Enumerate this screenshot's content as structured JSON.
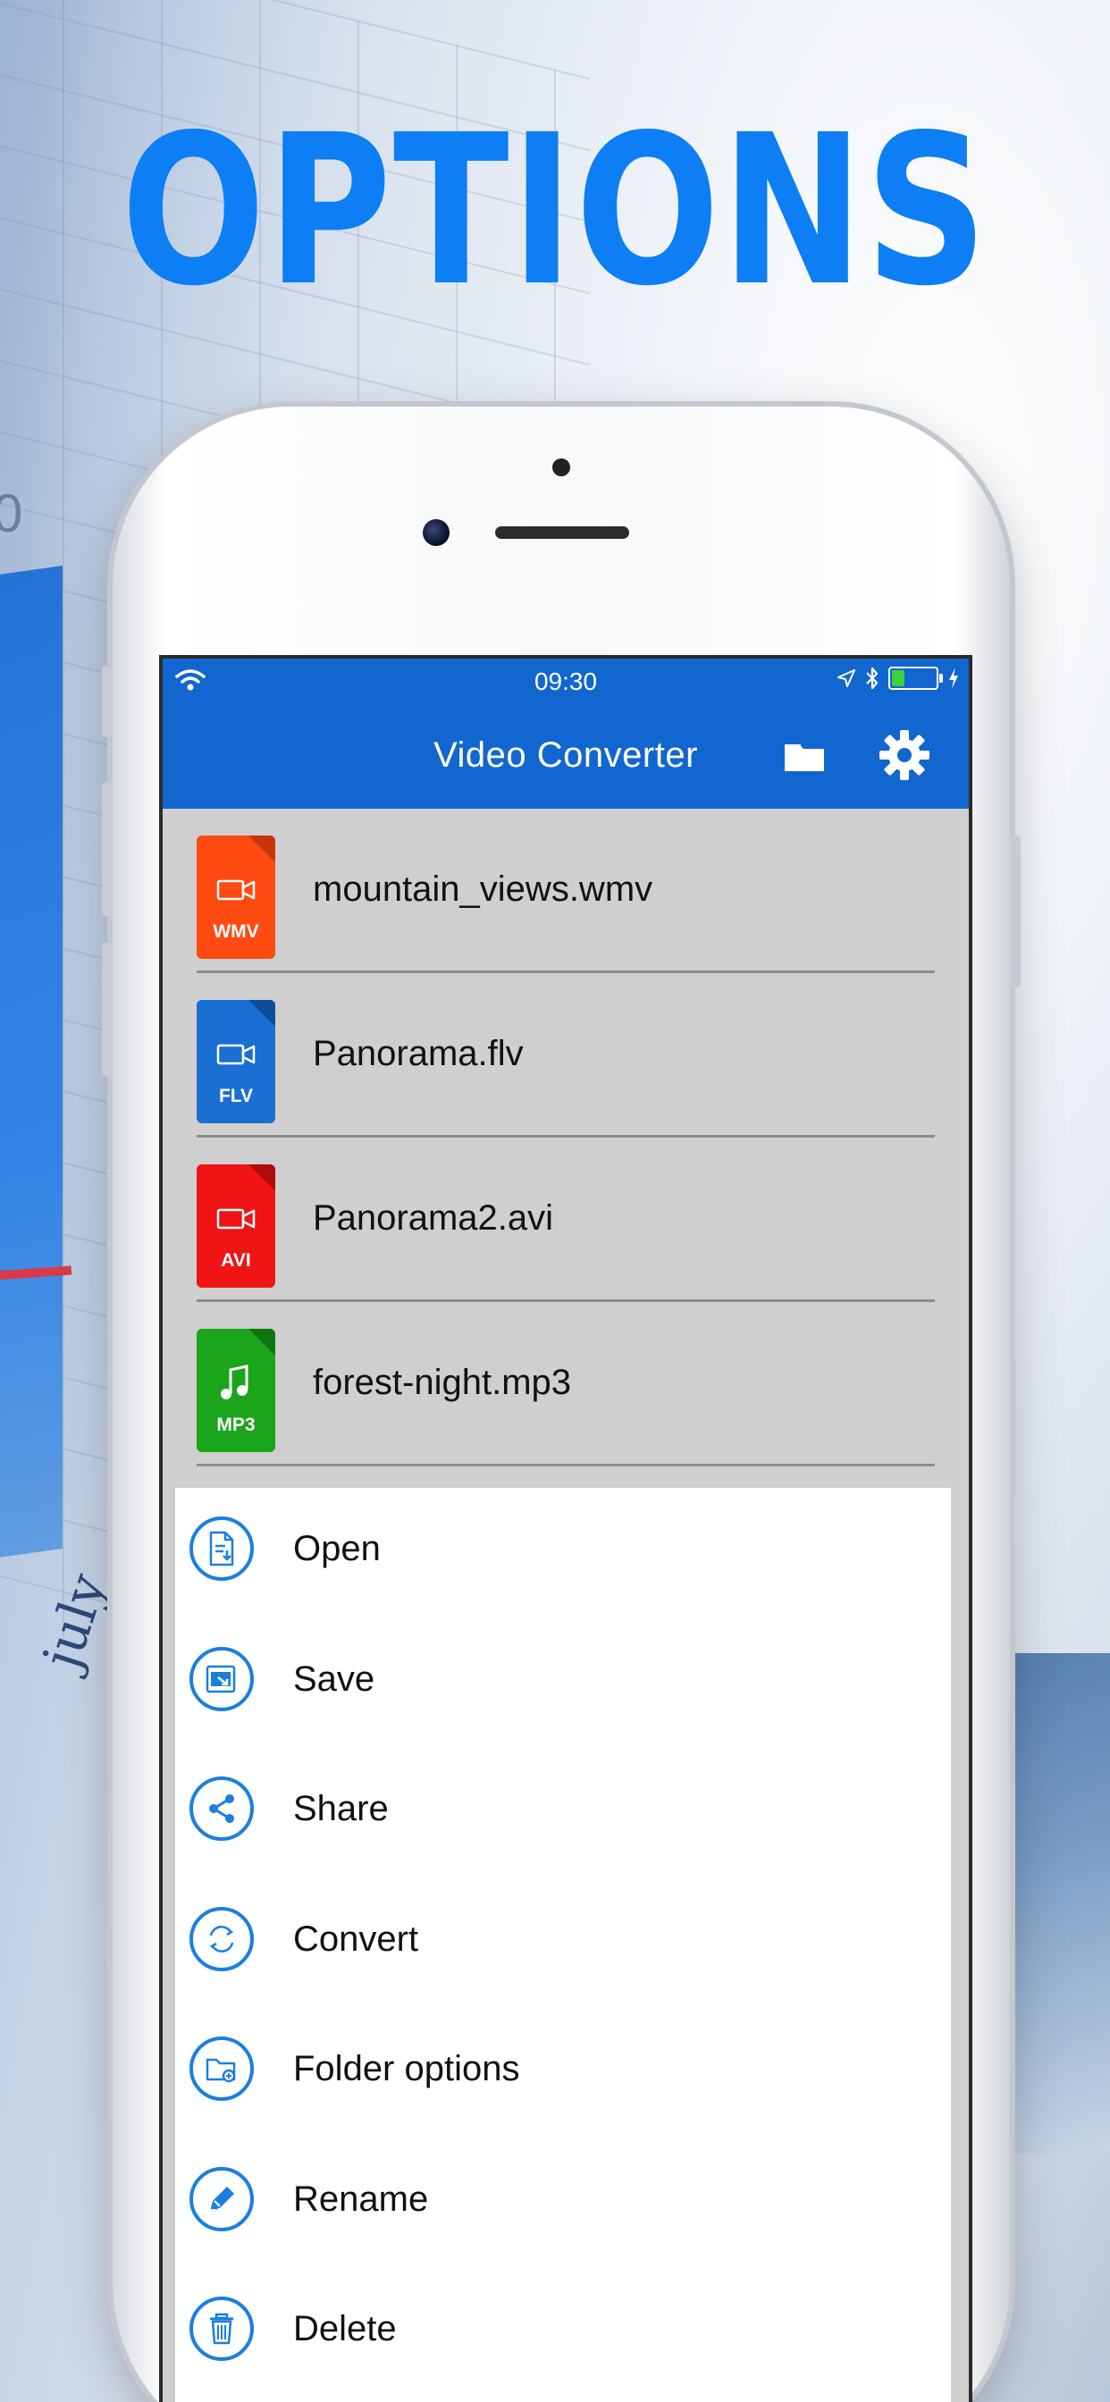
{
  "headline": "OPTIONS",
  "background": {
    "chart_axis_label": "july",
    "chart_tick": "0"
  },
  "status_bar": {
    "time": "09:30"
  },
  "nav": {
    "title": "Video Converter",
    "folder_icon": "folder-icon",
    "settings_icon": "gear-icon"
  },
  "files": [
    {
      "name": "mountain_views.wmv",
      "ext": "WMV",
      "color": "#ff4a12",
      "corner": "#c6350a",
      "icon": "video-camera-icon"
    },
    {
      "name": "Panorama.flv",
      "ext": "FLV",
      "color": "#1a6fd2",
      "corner": "#0d4d9c",
      "icon": "video-camera-icon"
    },
    {
      "name": "Panorama2.avi",
      "ext": "AVI",
      "color": "#f01414",
      "corner": "#b00c0c",
      "icon": "video-camera-icon"
    },
    {
      "name": "forest-night.mp3",
      "ext": "MP3",
      "color": "#1aa51a",
      "corner": "#0f760f",
      "icon": "music-note-icon"
    }
  ],
  "actions": [
    {
      "label": "Open",
      "icon": "open-document-icon"
    },
    {
      "label": "Save",
      "icon": "save-icon"
    },
    {
      "label": "Share",
      "icon": "share-icon"
    },
    {
      "label": "Convert",
      "icon": "convert-icon"
    },
    {
      "label": "Folder options",
      "icon": "folder-options-icon"
    },
    {
      "label": "Rename",
      "icon": "rename-pencil-icon"
    },
    {
      "label": "Delete",
      "icon": "trash-icon"
    }
  ],
  "colors": {
    "accent": "#1266d0",
    "headline": "#0d7ef3",
    "action_ring": "#1a7fe0"
  }
}
